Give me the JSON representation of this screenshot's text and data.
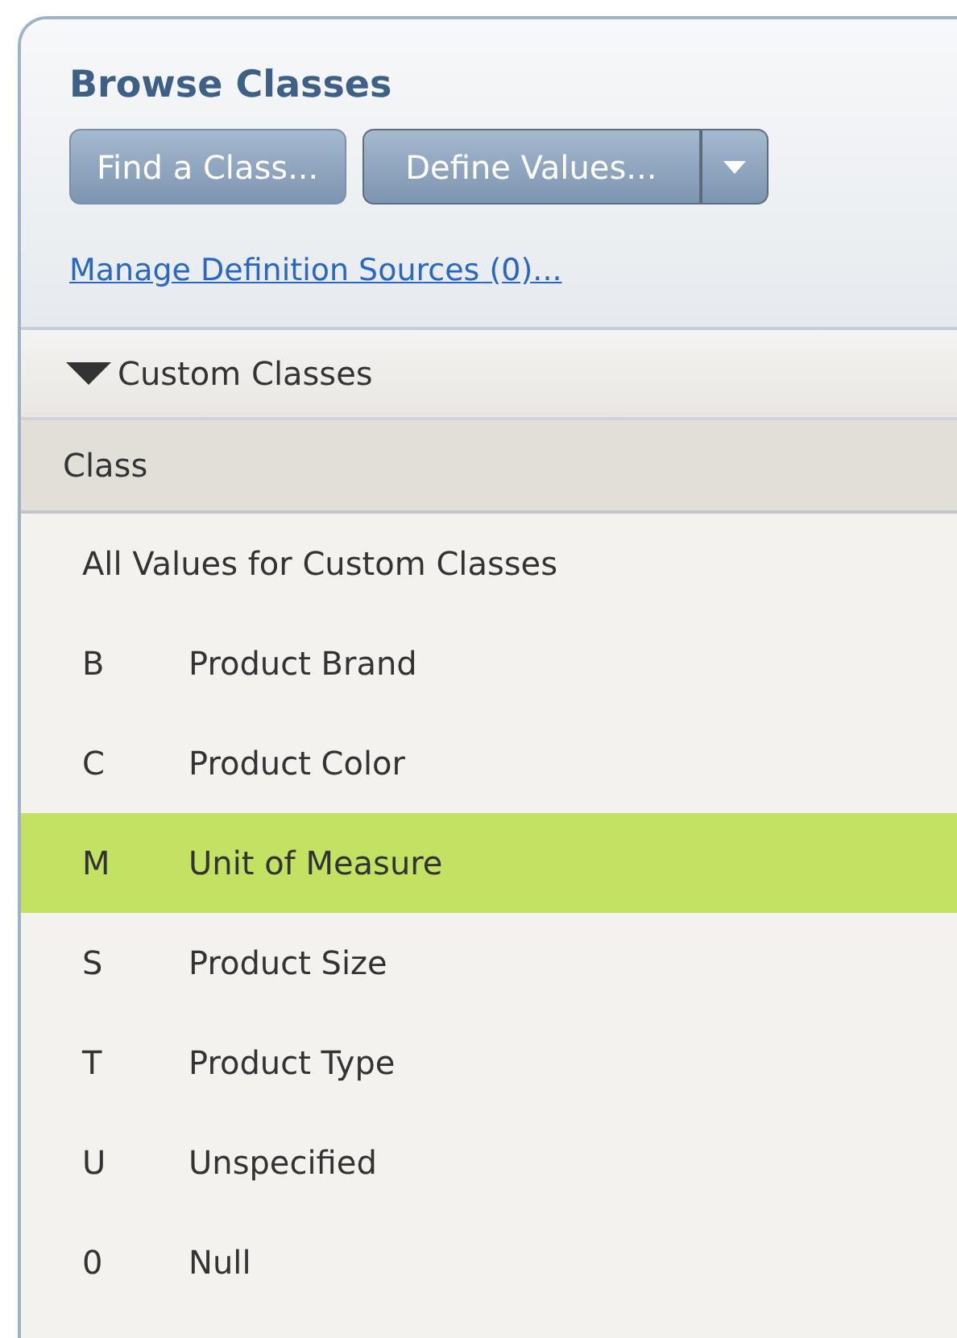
{
  "panel": {
    "title": "Browse Classes",
    "buttons": [
      {
        "label": "Find a Class...",
        "kind": "plain"
      },
      {
        "label": "Define Values...",
        "kind": "split"
      }
    ],
    "link": "Manage Definition Sources (0)...",
    "section": {
      "label": "Custom Classes",
      "expanded": true
    },
    "table": {
      "columns": [
        "Class"
      ],
      "rows": [
        {
          "kind": "all",
          "name": "All Values for Custom Classes",
          "selected": false
        },
        {
          "kind": "class",
          "code": "B",
          "name": "Product Brand",
          "selected": false
        },
        {
          "kind": "class",
          "code": "C",
          "name": "Product Color",
          "selected": false
        },
        {
          "kind": "class",
          "code": "M",
          "name": "Unit of Measure",
          "selected": true
        },
        {
          "kind": "class",
          "code": "S",
          "name": "Product Size",
          "selected": false
        },
        {
          "kind": "class",
          "code": "T",
          "name": "Product Type",
          "selected": false
        },
        {
          "kind": "class",
          "code": "U",
          "name": "Unspecified",
          "selected": false
        },
        {
          "kind": "class",
          "code": "0",
          "name": "Null",
          "selected": false
        }
      ]
    }
  }
}
